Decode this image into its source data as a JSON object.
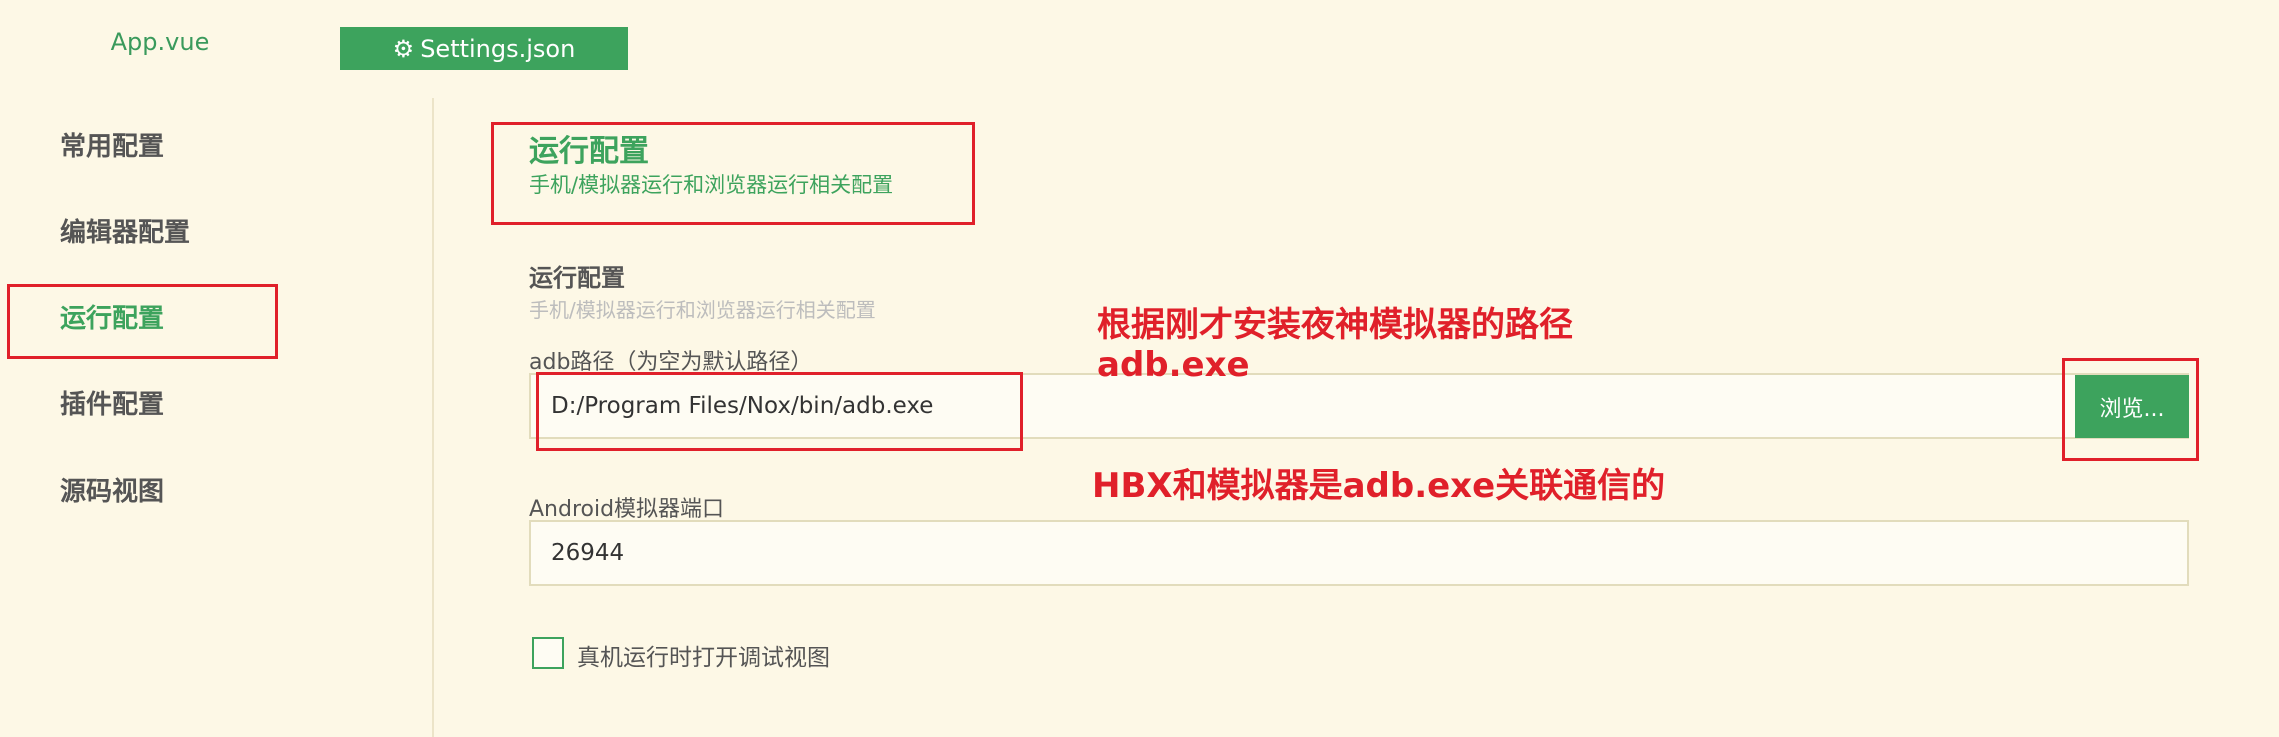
{
  "tabs": [
    {
      "label": "App.vue"
    },
    {
      "label": "Settings.json",
      "icon": "gear-icon"
    }
  ],
  "sidebar": {
    "items": [
      {
        "label": "常用配置"
      },
      {
        "label": "编辑器配置"
      },
      {
        "label": "运行配置",
        "active": true
      },
      {
        "label": "插件配置"
      },
      {
        "label": "源码视图"
      }
    ]
  },
  "main": {
    "title": "运行配置",
    "subtitle": "手机/模拟器运行和浏览器运行相关配置",
    "section": {
      "title": "运行配置",
      "description": "手机/模拟器运行和浏览器运行相关配置"
    },
    "adb": {
      "label": "adb路径（为空为默认路径）",
      "value": "D:/Program Files/Nox/bin/adb.exe",
      "browse_label": "浏览..."
    },
    "port": {
      "label": "Android模拟器端口",
      "value": "26944"
    },
    "debug_checkbox": {
      "label": "真机运行时打开调试视图",
      "checked": false
    }
  },
  "annotations": {
    "line1": "根据刚才安装夜神模拟器的路径",
    "line2": "adb.exe",
    "line3": "HBX和模拟器是adb.exe关联通信的"
  },
  "colors": {
    "accent": "#3da35d",
    "background": "#fdf8e6",
    "annotation": "#e0202a"
  }
}
